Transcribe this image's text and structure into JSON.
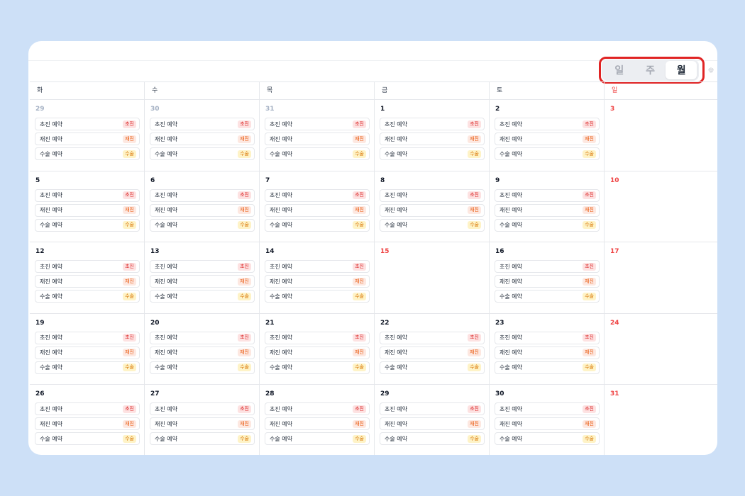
{
  "view_toggle": {
    "day": "일",
    "week": "주",
    "month": "월",
    "active": "month"
  },
  "weekdays": [
    "화",
    "수",
    "목",
    "금",
    "토",
    "일"
  ],
  "event_types": [
    {
      "label": "초진 예약",
      "badge": "초진",
      "tone": "r1"
    },
    {
      "label": "재진 예약",
      "badge": "재진",
      "tone": "r2"
    },
    {
      "label": "수술 예약",
      "badge": "수술",
      "tone": "r3"
    }
  ],
  "weeks": [
    [
      {
        "day": "29",
        "style": "muted",
        "events": true
      },
      {
        "day": "30",
        "style": "muted",
        "events": true
      },
      {
        "day": "31",
        "style": "muted",
        "events": true
      },
      {
        "day": "1",
        "style": "normal",
        "events": true
      },
      {
        "day": "2",
        "style": "normal",
        "events": true
      },
      {
        "day": "3",
        "style": "red",
        "events": false
      }
    ],
    [
      {
        "day": "5",
        "style": "normal",
        "events": true
      },
      {
        "day": "6",
        "style": "normal",
        "events": true
      },
      {
        "day": "7",
        "style": "normal",
        "events": true
      },
      {
        "day": "8",
        "style": "normal",
        "events": true
      },
      {
        "day": "9",
        "style": "normal",
        "events": true
      },
      {
        "day": "10",
        "style": "red",
        "events": false
      }
    ],
    [
      {
        "day": "12",
        "style": "normal",
        "events": true
      },
      {
        "day": "13",
        "style": "normal",
        "events": true
      },
      {
        "day": "14",
        "style": "normal",
        "events": true
      },
      {
        "day": "15",
        "style": "red",
        "events": false
      },
      {
        "day": "16",
        "style": "normal",
        "events": true
      },
      {
        "day": "17",
        "style": "red",
        "events": false
      }
    ],
    [
      {
        "day": "19",
        "style": "normal",
        "events": true
      },
      {
        "day": "20",
        "style": "normal",
        "events": true
      },
      {
        "day": "21",
        "style": "normal",
        "events": true
      },
      {
        "day": "22",
        "style": "normal",
        "events": true
      },
      {
        "day": "23",
        "style": "normal",
        "events": true
      },
      {
        "day": "24",
        "style": "red",
        "events": false
      }
    ],
    [
      {
        "day": "26",
        "style": "normal",
        "events": true
      },
      {
        "day": "27",
        "style": "normal",
        "events": true
      },
      {
        "day": "28",
        "style": "normal",
        "events": true
      },
      {
        "day": "29",
        "style": "normal",
        "events": true
      },
      {
        "day": "30",
        "style": "normal",
        "events": true
      },
      {
        "day": "31",
        "style": "red",
        "events": false
      }
    ]
  ],
  "icons": {
    "settings": "sun-settings-icon"
  },
  "colors": {
    "background": "#cde0f7",
    "highlight": "#e02424",
    "holiday": "#ef4444"
  }
}
